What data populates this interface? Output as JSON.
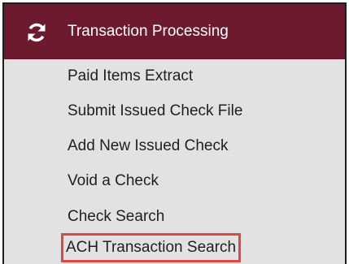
{
  "section": {
    "title": "Transaction Processing",
    "icon": "sync-icon",
    "header_color": "#6d1a2e"
  },
  "menu": {
    "items": [
      {
        "label": "Paid Items Extract"
      },
      {
        "label": "Submit Issued Check File"
      },
      {
        "label": "Add New Issued Check"
      },
      {
        "label": "Void a Check"
      },
      {
        "label": "Check Search"
      },
      {
        "label": "ACH Transaction Search",
        "highlighted": true
      }
    ],
    "highlight_color": "#e0473f"
  }
}
